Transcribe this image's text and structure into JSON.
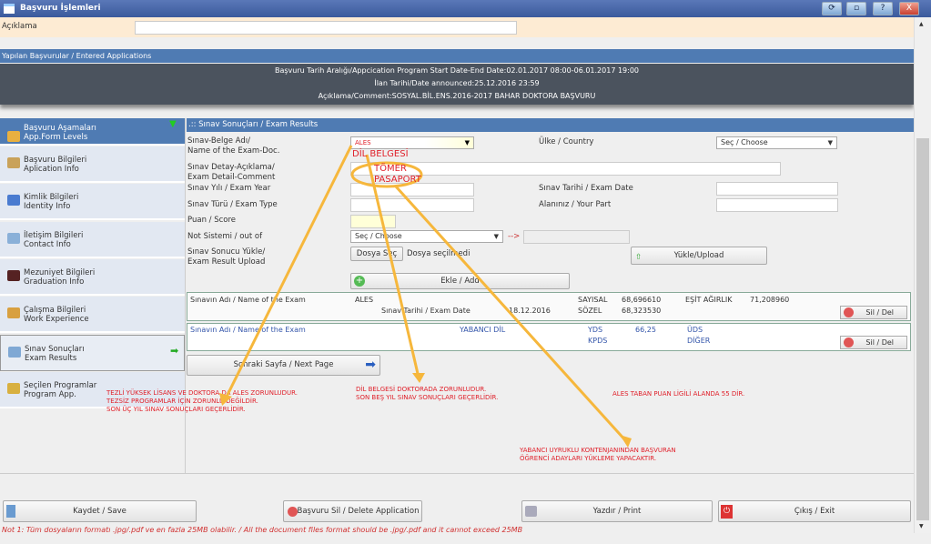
{
  "window": {
    "title": "Başvuru İşlemleri",
    "buttons": [
      "refresh",
      "maximize",
      "help",
      "close"
    ],
    "btn_glyphs": [
      "⟳",
      "▫",
      "?",
      "X"
    ]
  },
  "description": {
    "label": "Açıklama",
    "value": ""
  },
  "entered": {
    "header": "Yapılan Başvurular / Entered Applications",
    "lines": [
      "Başvuru Tarih Aralığı/Appcication Program Start Date-End Date:02.01.2017 08:00-06.01.2017 19:00",
      "İlan Tarihi/Date announced:25.12.2016 23:59",
      "Açıklama/Comment:SOSYAL.BİL.ENS.2016-2017 BAHAR DOKTORA BAŞVURU"
    ]
  },
  "sidebar": {
    "header": [
      "Başvuru Aşamaları",
      "App.Form Levels"
    ],
    "items": [
      {
        "l1": "Başvuru Bilgileri",
        "l2": "Aplication Info",
        "color": "#c9a25a"
      },
      {
        "l1": "Kimlik Bilgileri",
        "l2": "Identity Info",
        "color": "#4a7bd0"
      },
      {
        "l1": "İletişim Bilgileri",
        "l2": "Contact Info",
        "color": "#8ab0d8"
      },
      {
        "l1": "Mezuniyet Bilgileri",
        "l2": "Graduation Info",
        "color": "#552222"
      },
      {
        "l1": "Çalışma Bilgileri",
        "l2": "Work Experience",
        "color": "#d8a040"
      },
      {
        "l1": "Sınav Sonuçları",
        "l2": "Exam Results",
        "color": "#7fa8d4"
      },
      {
        "l1": "Seçilen Programlar",
        "l2": "Program App.",
        "color": "#d8b040"
      }
    ]
  },
  "form": {
    "header": ".:: Sınav Sonuçları / Exam Results",
    "exam_name_label": [
      "Sınav-Belge Adı/",
      "Name of the Exam-Doc."
    ],
    "exam_name_value": "ALES",
    "dropdown_options": [
      "DİL BELGESİ",
      "TÖMER",
      "PASAPORT"
    ],
    "country_label": "Ülke / Country",
    "country_value": "Seç / Choose",
    "detail_label": [
      "Sınav Detay-Açıklama/",
      "Exam Detail-Comment"
    ],
    "year_label": "Sınav Yılı / Exam Year",
    "date_label": "Sınav Tarihi / Exam Date",
    "type_label": "Sınav Türü / Exam Type",
    "part_label": "Alanınız / Your Part",
    "score_label": "Puan / Score",
    "grading_label": "Not Sistemi / out of",
    "grading_value": "Seç / Choose",
    "arrow": "-->",
    "upload_label": [
      "Sınav Sonucu Yükle/",
      "Exam Result Upload"
    ],
    "file_button": "Dosya Seç",
    "file_status": "Dosya seçilmedi",
    "upload_button": "Yükle/Upload",
    "add_button": "Ekle / Add"
  },
  "results": [
    {
      "name_label": "Sınavın Adı / Name of the Exam",
      "name": "ALES",
      "date_label": "Sınav Tarihi / Exam Date",
      "date": "18.12.2016",
      "k1": "SAYISAL",
      "v1": "68,696610",
      "k2": "SÖZEL",
      "v2": "68,323530",
      "k3": "EŞİT AĞIRLIK",
      "v3": "71,208960",
      "del": "Sil / Del"
    },
    {
      "name_label": "Sınavın Adı / Name of the Exam",
      "name": "YABANCI DİL",
      "k1": "YDS",
      "v1": "66,25",
      "k2": "KPDS",
      "k3": "ÜDS",
      "k4": "DİĞER",
      "del": "Sil / Del"
    }
  ],
  "next_page": "Sonraki Sayfa / Next Page",
  "notes": {
    "n1": [
      "TEZLİ YÜKSEK LİSANS VE DOKTORA DA ALES ZORUNLUDUR.",
      "TEZSİZ PROGRAMLAR İÇİN ZORUNLU DEĞİLDİR.",
      "SON ÜÇ YIL SINAV SONUÇLARI GEÇERLİDİR."
    ],
    "n2": [
      "DİL BELGESİ DOKTORADA ZORUNLUDUR.",
      "SON BEŞ YIL SINAV SONUÇLARI GEÇERLİDİR."
    ],
    "n3": "ALES TABAN PUAN LİGİLİ ALANDA 55 DİR.",
    "n4": [
      "YABANCI UYRUKLU KONTENJANINDAN BAŞVURAN",
      "ÖĞRENCİ ADAYLARI YÜKLEME YAPACAKTIR."
    ]
  },
  "footer": {
    "save": "Kaydet / Save",
    "delete": "Başvuru Sil / Delete Application",
    "print": "Yazdır / Print",
    "exit": "Çıkış / Exit",
    "note": "Not 1: Tüm dosyaların formatı .jpg/.pdf ve en fazla 25MB olabilir. / All the document files format should be .jpg/.pdf and it cannot exceed 25MB"
  },
  "colors": {
    "annotation": "#f6b73c",
    "note_red": "#e0202a",
    "header_blue": "#4f7bb3"
  }
}
